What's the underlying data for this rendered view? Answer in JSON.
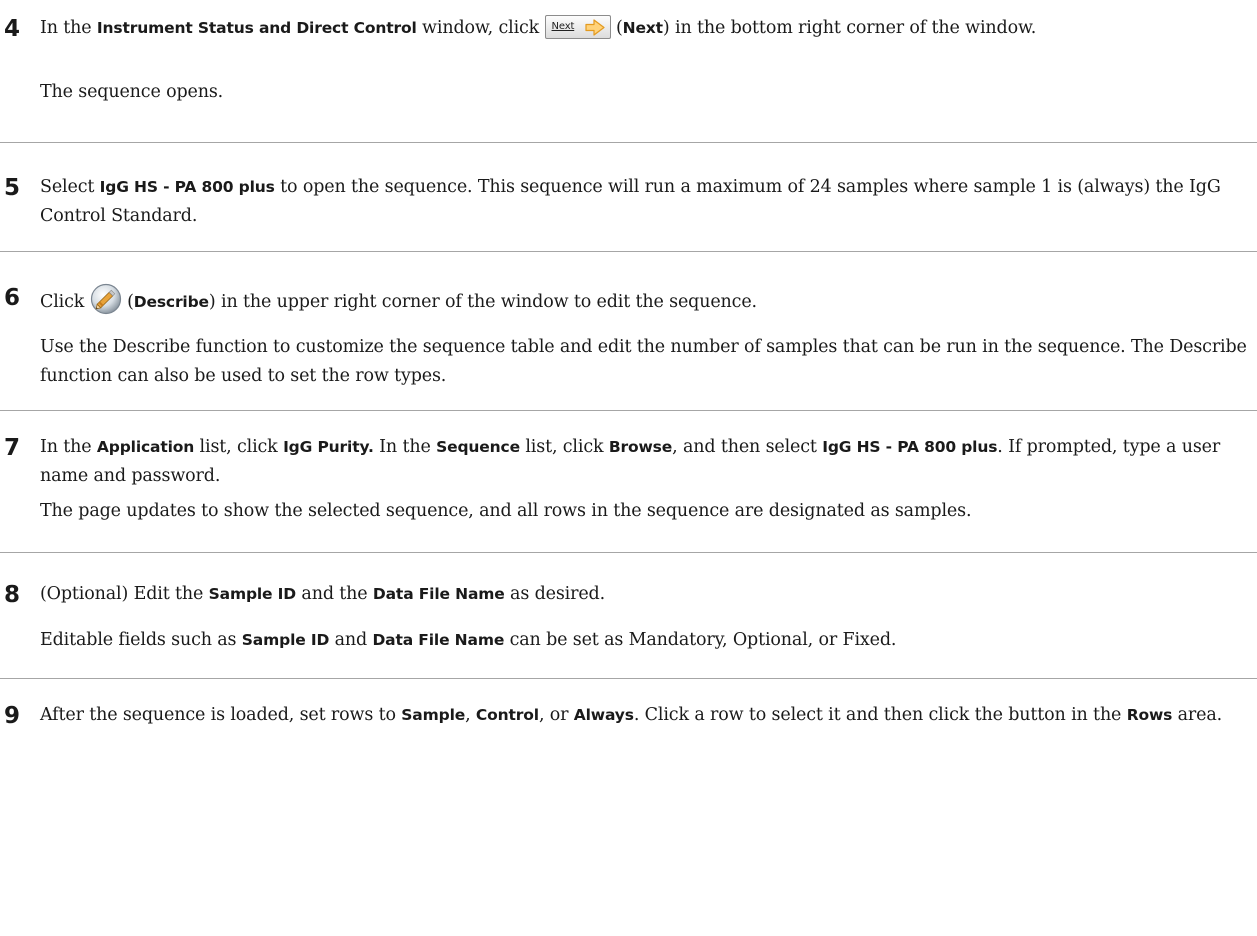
{
  "steps": [
    {
      "num": "4",
      "p1": {
        "t1": "In the ",
        "b1": "Instrument Status and Direct Control",
        "t2": " window, click ",
        "btn_label": "Next",
        "t3": " (",
        "b2": "Next",
        "t4": ") in the bottom right corner of the window."
      },
      "p2": "The sequence opens."
    },
    {
      "num": "5",
      "p1": {
        "t1": "Select ",
        "b1": "IgG HS - PA 800 plus",
        "t2": " to open the sequence. This sequence will run a maximum of 24 samples where sample 1 is (always) the IgG Control Standard."
      }
    },
    {
      "num": "6",
      "p1": {
        "t1": "Click ",
        "t2": " (",
        "b1": "Describe",
        "t3": ") in the upper right corner of the window to edit the sequence."
      },
      "p2": "Use the Describe function to customize the sequence table and edit the number of samples that can be run in the sequence. The Describe function can also be used to set the row types."
    },
    {
      "num": "7",
      "p1": {
        "t1": "In the ",
        "b1": "Application",
        "t2": " list, click ",
        "b2": "IgG Purity.",
        "t3": " In the ",
        "b3": "Sequence",
        "t4": " list, click ",
        "b4": "Browse",
        "t5": ", and then select ",
        "b5": "IgG HS - PA 800 plus",
        "t6": ". If prompted, type a user name and password."
      },
      "p2": "The page updates to show the selected sequence, and all rows in the sequence are designated as samples."
    },
    {
      "num": "8",
      "p1": {
        "t1": "(Optional) Edit the ",
        "b1": "Sample ID",
        "t2": " and the ",
        "b2": "Data File Name",
        "t3": " as desired."
      },
      "p2": {
        "t1": "Editable fields such as ",
        "b1": "Sample ID",
        "t2": " and ",
        "b2": "Data File Name",
        "t3": " can be set as Mandatory, Optional, or Fixed."
      }
    },
    {
      "num": "9",
      "p1": {
        "t1": "After the sequence is loaded, set rows to ",
        "b1": "Sample",
        "t2": ", ",
        "b2": "Control",
        "t3": ", or ",
        "b3": "Always",
        "t4": ". Click a row to select it and then click the button in the ",
        "b4": "Rows",
        "t5": " area."
      }
    }
  ],
  "icons": {
    "next_arrow": "arrow-right-icon",
    "describe": "pencil-describe-icon"
  },
  "colors": {
    "text": "#1a1a1a",
    "rule": "#a6a6a6",
    "arrow_fill": "#ffd27a",
    "arrow_stroke": "#e39a1f"
  }
}
